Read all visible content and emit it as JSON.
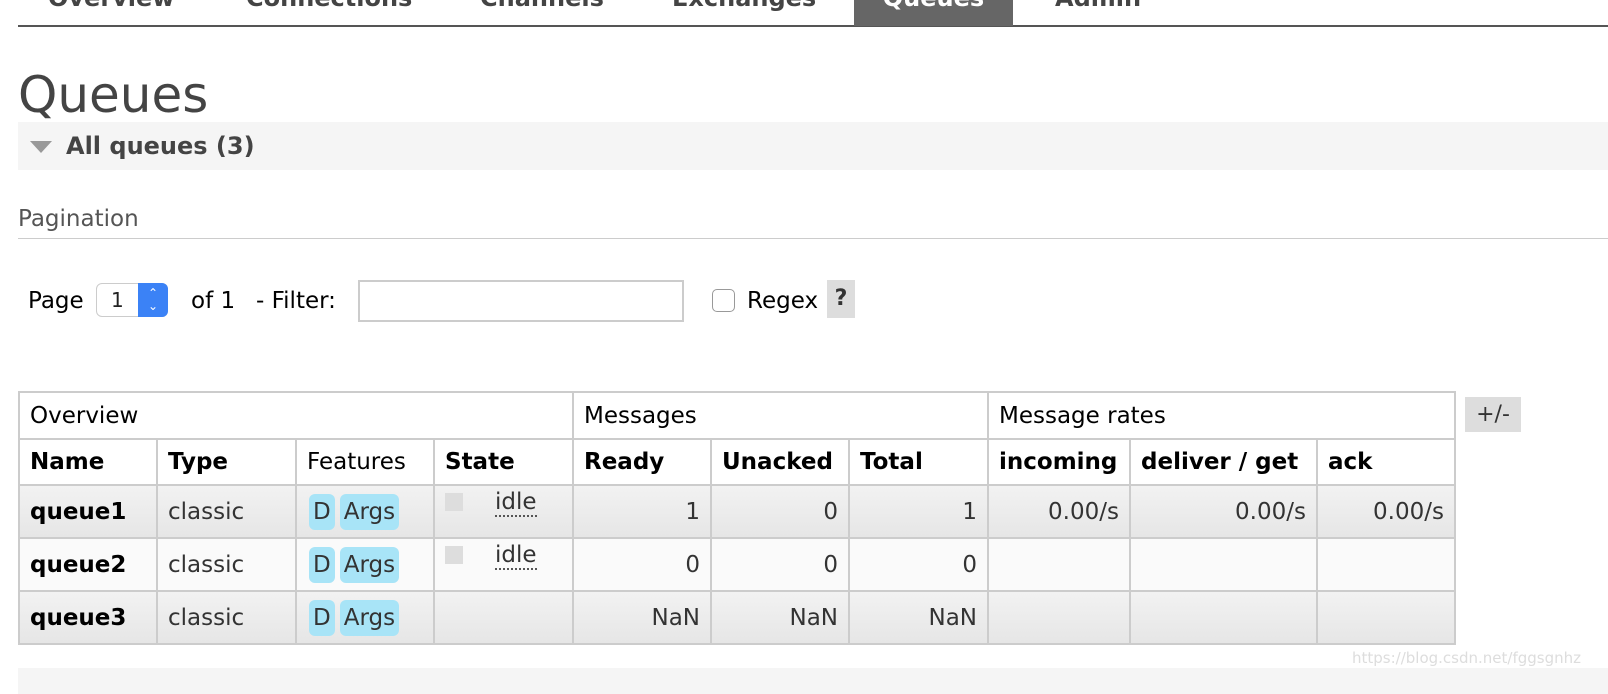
{
  "nav": {
    "tabs": [
      {
        "label": "Overview",
        "active": false
      },
      {
        "label": "Connections",
        "active": false
      },
      {
        "label": "Channels",
        "active": false
      },
      {
        "label": "Exchanges",
        "active": false
      },
      {
        "label": "Queues",
        "active": true
      },
      {
        "label": "Admin",
        "active": false
      }
    ]
  },
  "page": {
    "title": "Queues",
    "section_title": "All queues (3)"
  },
  "pagination": {
    "label": "Pagination",
    "page_label": "Page",
    "page_value": "1",
    "of_label": "of 1",
    "filter_label": "- Filter:",
    "filter_value": "",
    "regex_label": "Regex",
    "help_label": "?",
    "regex_checked": false
  },
  "table": {
    "groups": [
      "Overview",
      "Messages",
      "Message rates"
    ],
    "columns": [
      "Name",
      "Type",
      "Features",
      "State",
      "Ready",
      "Unacked",
      "Total",
      "incoming",
      "deliver / get",
      "ack"
    ],
    "toggle_label": "+/-",
    "rows": [
      {
        "name": "queue1",
        "type": "classic",
        "features": [
          "D",
          "Args"
        ],
        "state": "idle",
        "ready": "1",
        "unacked": "0",
        "total": "1",
        "incoming": "0.00/s",
        "deliver_get": "0.00/s",
        "ack": "0.00/s"
      },
      {
        "name": "queue2",
        "type": "classic",
        "features": [
          "D",
          "Args"
        ],
        "state": "idle",
        "ready": "0",
        "unacked": "0",
        "total": "0",
        "incoming": "",
        "deliver_get": "",
        "ack": ""
      },
      {
        "name": "queue3",
        "type": "classic",
        "features": [
          "D",
          "Args"
        ],
        "state": "",
        "ready": "NaN",
        "unacked": "NaN",
        "total": "NaN",
        "incoming": "",
        "deliver_get": "",
        "ack": ""
      }
    ]
  },
  "watermark": "https://blog.csdn.net/fggsgnhz",
  "colors": {
    "active_tab": "#666666",
    "badge": "#a8e4f7",
    "stepper": "#3b82f6"
  }
}
